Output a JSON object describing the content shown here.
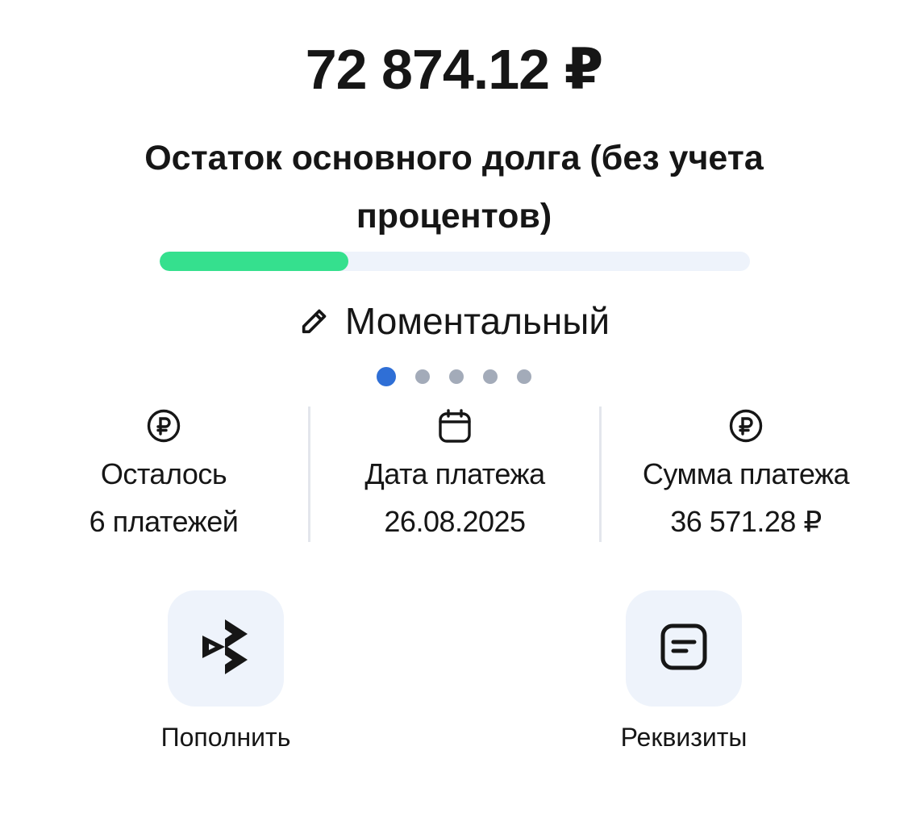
{
  "balance": {
    "amount": "72 874.12 ₽",
    "caption": "Остаток основного долга (без учета процентов)",
    "progress_fraction": 0.32,
    "progress_color": "#35e08e"
  },
  "card": {
    "name": "Моментальный",
    "edit_icon": "pencil-icon"
  },
  "pager": {
    "count": 5,
    "active_index": 0,
    "active_color": "#2f6fd6"
  },
  "stats": [
    {
      "icon": "ruble-icon",
      "label": "Осталось",
      "value": "6 платежей"
    },
    {
      "icon": "calendar-icon",
      "label": "Дата платежа",
      "value": "26.08.2025"
    },
    {
      "icon": "ruble-icon",
      "label": "Сумма платежа",
      "value": "36 571.28 ₽"
    }
  ],
  "actions": [
    {
      "icon": "top-up-icon",
      "label": "Пополнить"
    },
    {
      "icon": "document-icon",
      "label": "Реквизиты"
    }
  ]
}
